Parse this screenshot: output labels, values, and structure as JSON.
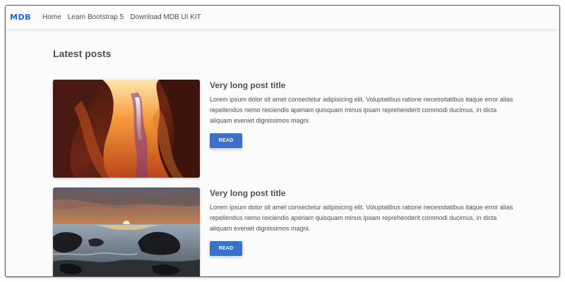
{
  "navbar": {
    "brand": "MDB",
    "links": [
      {
        "label": "Home"
      },
      {
        "label": "Learn Bootstrap 5"
      },
      {
        "label": "Download MDB UI KIT"
      }
    ]
  },
  "main": {
    "section_title": "Latest posts",
    "posts": [
      {
        "title": "Very long post title",
        "text": "Lorem ipsum dolor sit amet consectetur adipisicing elit. Voluptatibus ratione necessitatibus itaque error alias repellendus nemo reiciendis aperiam quisquam minus ipsam reprehenderit commodi ducimus, in dicta aliquam eveniet dignissimos magni.",
        "button_label": "READ",
        "image": "canyon-photo"
      },
      {
        "title": "Very long post title",
        "text": "Lorem ipsum dolor sit amet consectetur adipisicing elit. Voluptatibus ratione necessitatibus itaque error alias repellendus nemo reiciendis aperiam quisquam minus ipsam reprehenderit commodi ducimus, in dicta aliquam eveniet dignissimos magni.",
        "button_label": "READ",
        "image": "sunset-sea-photo"
      }
    ]
  },
  "colors": {
    "brand": "#1d66d9",
    "button": "#3b71ca",
    "text": "#4f4f4f",
    "background": "#fbfbfb"
  }
}
